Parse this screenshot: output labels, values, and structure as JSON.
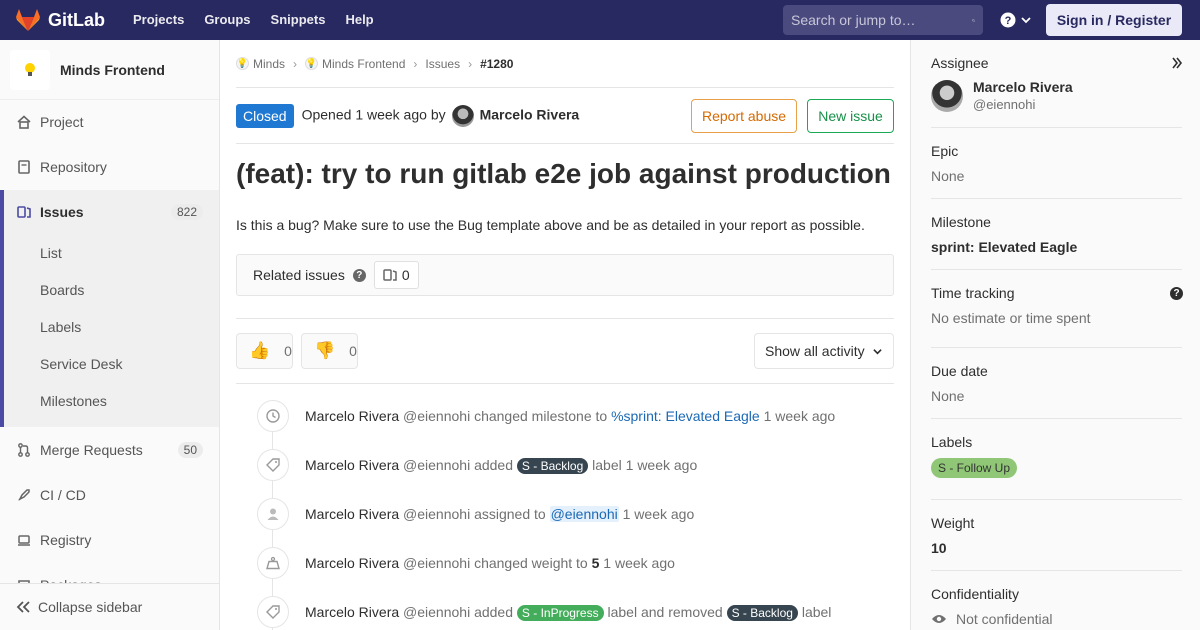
{
  "navbar": {
    "brand": "GitLab",
    "links": [
      "Projects",
      "Groups",
      "Snippets",
      "Help"
    ],
    "search_placeholder": "Search or jump to…",
    "signin": "Sign in / Register"
  },
  "sidebar": {
    "project_name": "Minds Frontend",
    "items": [
      {
        "label": "Project",
        "icon": "home-icon"
      },
      {
        "label": "Repository",
        "icon": "doc-icon"
      },
      {
        "label": "Issues",
        "icon": "issues-icon",
        "count": "822"
      },
      {
        "label": "Merge Requests",
        "icon": "merge-icon",
        "count": "50"
      },
      {
        "label": "CI / CD",
        "icon": "rocket-icon"
      },
      {
        "label": "Registry",
        "icon": "disk-icon"
      },
      {
        "label": "Packages",
        "icon": "package-icon"
      }
    ],
    "issue_subitems": [
      "List",
      "Boards",
      "Labels",
      "Service Desk",
      "Milestones"
    ],
    "collapse": "Collapse sidebar"
  },
  "breadcrumb": [
    "Minds",
    "Minds Frontend",
    "Issues",
    "#1280"
  ],
  "issue": {
    "status": "Closed",
    "opened_prefix": "Opened",
    "opened_time": "1 week ago",
    "opened_by": "by",
    "author": "Marcelo Rivera",
    "report_abuse": "Report abuse",
    "new_issue": "New issue",
    "title": "(feat): try to run gitlab e2e job against production",
    "description": "Is this a bug? Make sure to use the Bug template above and be as detailed in your report as possible.",
    "related_label": "Related issues",
    "related_count": "0",
    "thumbs_up": "0",
    "thumbs_down": "0",
    "activity_filter": "Show all activity"
  },
  "notes": [
    {
      "author": "Marcelo Rivera",
      "user": "@eiennohi",
      "icon": "clock-icon",
      "parts": {
        "a": "changed milestone to",
        "link": "%sprint: Elevated Eagle",
        "time": "1 week ago"
      }
    },
    {
      "author": "Marcelo Rivera",
      "user": "@eiennohi",
      "icon": "tag-icon",
      "parts": {
        "a": "added",
        "label": "S - Backlog",
        "b": "label",
        "time": "1 week ago"
      }
    },
    {
      "author": "Marcelo Rivera",
      "user": "@eiennohi",
      "icon": "user-icon",
      "parts": {
        "a": "assigned to",
        "mention": "@eiennohi",
        "time": "1 week ago"
      }
    },
    {
      "author": "Marcelo Rivera",
      "user": "@eiennohi",
      "icon": "weight-icon",
      "parts": {
        "a": "changed weight to",
        "value": "5",
        "time": "1 week ago"
      }
    },
    {
      "author": "Marcelo Rivera",
      "user": "@eiennohi",
      "icon": "tag-icon",
      "parts": {
        "a": "added",
        "label1": "S - InProgress",
        "b": "label and removed",
        "label2": "S - Backlog",
        "c": "label"
      }
    }
  ],
  "right_sidebar": {
    "assignee_title": "Assignee",
    "assignee_name": "Marcelo Rivera",
    "assignee_user": "@eiennohi",
    "epic_title": "Epic",
    "epic_value": "None",
    "milestone_title": "Milestone",
    "milestone_value": "sprint: Elevated Eagle",
    "time_title": "Time tracking",
    "time_value": "No estimate or time spent",
    "due_title": "Due date",
    "due_value": "None",
    "labels_title": "Labels",
    "label_value": "S - Follow Up",
    "weight_title": "Weight",
    "weight_value": "10",
    "conf_title": "Confidentiality",
    "conf_value": "Not confidential"
  },
  "colors": {
    "navbar": "#292961",
    "closed": "#1f78d1",
    "backlog": "#36454f",
    "inprogress": "#44ad5b",
    "followup": "#8fc777"
  }
}
